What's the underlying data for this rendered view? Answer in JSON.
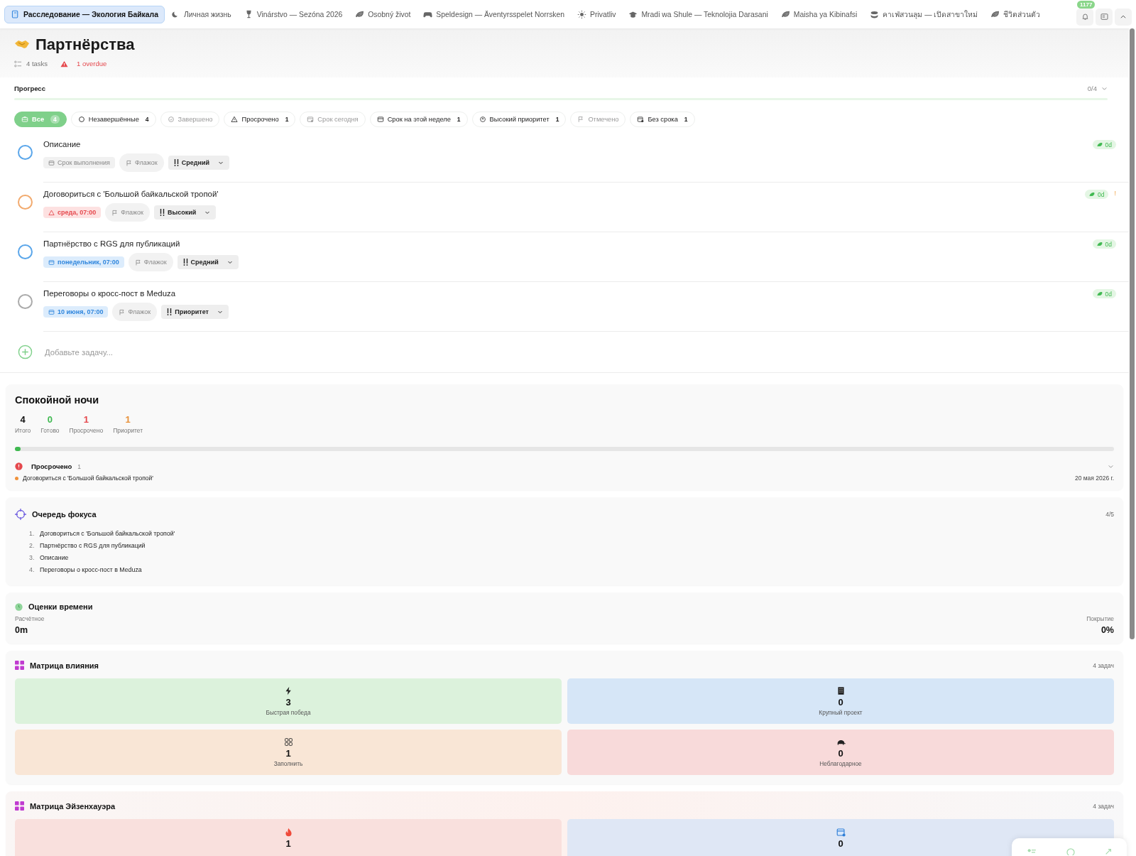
{
  "tabs": [
    {
      "label": "Расследование — Экология Байкала",
      "selected": true
    },
    {
      "label": "Личная жизнь",
      "selected": false
    },
    {
      "label": "Vinárstvo — Sezóna 2026",
      "selected": false
    },
    {
      "label": "Osobný život",
      "selected": false
    },
    {
      "label": "Speldesign — Äventyrsspelet Norrsken",
      "selected": false
    },
    {
      "label": "Privatliv",
      "selected": false
    },
    {
      "label": "Mradi wa Shule — Teknolojia Darasani",
      "selected": false
    },
    {
      "label": "Maisha ya Kibinafsi",
      "selected": false
    },
    {
      "label": "คาเฟ่สวนลุม — เปิดสาขาใหม่",
      "selected": false
    },
    {
      "label": "ชีวิตส่วนตัว",
      "selected": false
    }
  ],
  "notifications": {
    "badge": "1177"
  },
  "header": {
    "title": "Партнёрства",
    "tasks": "4 tasks",
    "overdue": "1 overdue"
  },
  "progress": {
    "label": "Прогресс",
    "count": "0/4",
    "level": 0
  },
  "filters": [
    {
      "label": "Все",
      "count": "4",
      "selected": true,
      "disabled": false
    },
    {
      "label": "Незавершённые",
      "count": "4",
      "selected": false,
      "disabled": false
    },
    {
      "label": "Завершено",
      "selected": false,
      "disabled": true
    },
    {
      "label": "Просрочено",
      "count": "1",
      "selected": false,
      "disabled": false
    },
    {
      "label": "Срок сегодня",
      "selected": false,
      "disabled": true
    },
    {
      "label": "Срок на этой неделе",
      "count": "1",
      "selected": false,
      "disabled": false
    },
    {
      "label": "Высокий приоритет",
      "count": "1",
      "selected": false,
      "disabled": false
    },
    {
      "label": "Отмечено",
      "selected": false,
      "disabled": true
    },
    {
      "label": "Без срока",
      "count": "1",
      "selected": false,
      "disabled": false
    }
  ],
  "tasks": [
    {
      "title": "Описание",
      "color": "#5aa6ea",
      "due": {
        "kind": "none",
        "text": "Срок выполнения"
      },
      "flag": "Флажок",
      "priority": "Средний",
      "age": "0d"
    },
    {
      "title": "Договориться с 'Большой байкальской тропой'",
      "color": "#f2aa6e",
      "due": {
        "kind": "overdue",
        "text": "среда, 07:00"
      },
      "flag": "Флажок",
      "priority": "Высокий",
      "age": "0d",
      "alert": "!"
    },
    {
      "title": "Партнёрство с RGS для публикаций",
      "color": "#5aa6ea",
      "due": {
        "kind": "upcoming",
        "text": "понедельник, 07:00"
      },
      "flag": "Флажок",
      "priority": "Средний",
      "age": "0d"
    },
    {
      "title": "Переговоры о кросс-пост в Meduza",
      "color": "#aaaaaa",
      "due": {
        "kind": "upcoming",
        "text": "10 июня, 07:00"
      },
      "flag": "Флажок",
      "priority": "Приоритет",
      "age": "0d"
    }
  ],
  "add_task": {
    "placeholder": "Добавьте задачу..."
  },
  "summary": {
    "title": "Спокойной ночи",
    "stats": [
      {
        "value": "4",
        "label": "Итого",
        "color": "#111111"
      },
      {
        "value": "0",
        "label": "Готово",
        "color": "#3fb950"
      },
      {
        "value": "1",
        "label": "Просрочено",
        "color": "#e5484d"
      },
      {
        "value": "1",
        "label": "Приоритет",
        "color": "#e8913a"
      }
    ],
    "level": 0.005,
    "overdue": {
      "title": "Просрочено",
      "count": "1",
      "items": [
        {
          "title": "Договориться с 'Большой байкальской тропой'",
          "date": "20 мая 2026 г."
        }
      ]
    }
  },
  "focus": {
    "title": "Очередь фокуса",
    "count": "4/5",
    "items": [
      {
        "number": "1.",
        "title": "Договориться с 'Большой байкальской тропой'"
      },
      {
        "number": "2.",
        "title": "Партнёрство с RGS для публикаций"
      },
      {
        "number": "3.",
        "title": "Описание"
      },
      {
        "number": "4.",
        "title": "Переговоры о кросс-пост в Meduza"
      }
    ]
  },
  "time": {
    "title": "Оценки времени",
    "estimate_label": "Расчётное",
    "estimate": "0m",
    "coverage_label": "Покрытие",
    "coverage": "0%"
  },
  "impact_matrix": {
    "title": "Матрица влияния",
    "count": "4 задач",
    "cells": [
      {
        "value": "3",
        "label": "Быстрая победа",
        "color": "#dcf2dc"
      },
      {
        "value": "0",
        "label": "Крупный проект",
        "color": "#d6e6f7"
      },
      {
        "value": "1",
        "label": "Заполнить",
        "color": "#f9e6d6"
      },
      {
        "value": "0",
        "label": "Неблагодарное",
        "color": "#f8dada"
      }
    ]
  },
  "eisenhower_matrix": {
    "title": "Матрица Эйзенхауэра",
    "count": "4 задач",
    "cells": [
      {
        "value": "1",
        "color": "#f9e0dd"
      },
      {
        "value": "0",
        "color": "#dfe7f5"
      }
    ]
  }
}
